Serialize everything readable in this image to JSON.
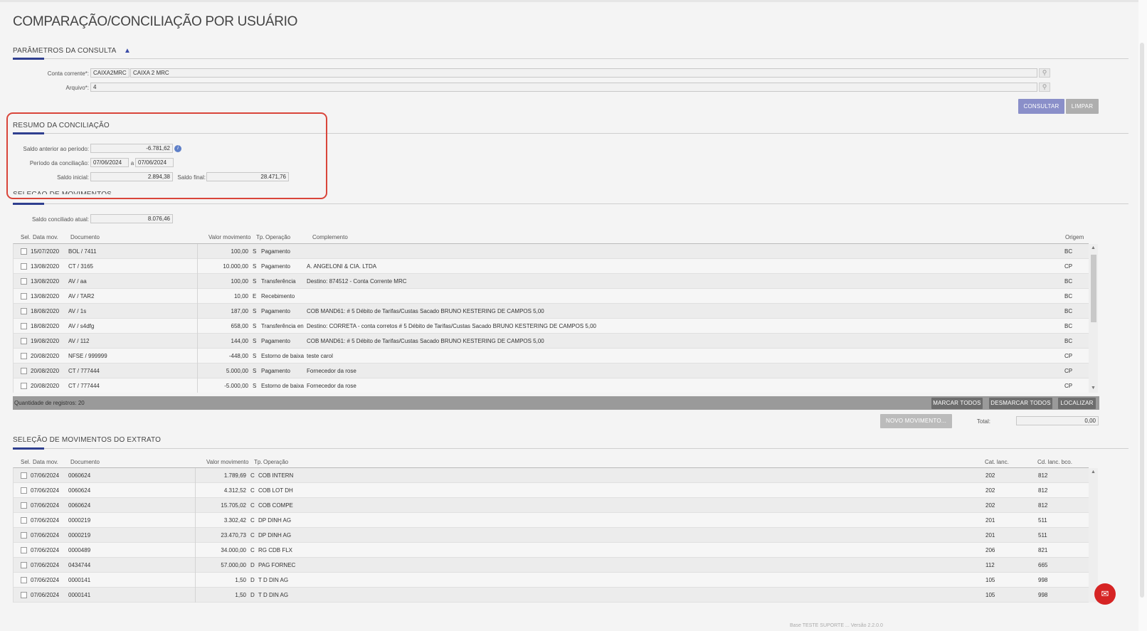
{
  "page_title": "COMPARAÇÃO/CONCILIAÇÃO POR USUÁRIO",
  "params": {
    "title": "PARÂMETROS DA CONSULTA",
    "conta_label": "Conta corrente*:",
    "conta_code": "CAIXA2MRC",
    "conta_name": "CAIXA 2 MRC",
    "arquivo_label": "Arquivo*:",
    "arquivo_value": "4",
    "consultar": "CONSULTAR",
    "limpar": "LIMPAR"
  },
  "resumo": {
    "title": "RESUMO DA CONCILIAÇÃO",
    "saldo_anterior_label": "Saldo anterior ao período:",
    "saldo_anterior": "-6.781,62",
    "periodo_label": "Período da conciliação:",
    "periodo_de": "07/06/2024",
    "periodo_sep": "a",
    "periodo_ate": "07/06/2024",
    "saldo_inicial_label": "Saldo inicial:",
    "saldo_inicial": "2.894,38",
    "saldo_final_label": "Saldo final:",
    "saldo_final": "28.471,76"
  },
  "movimentos": {
    "title": "SELEÇÃO DE MOVIMENTOS",
    "saldo_conciliado_label": "Saldo conciliado atual:",
    "saldo_conciliado": "8.076,46",
    "headers": {
      "sel": "Sel.",
      "data": "Data mov.",
      "documento": "Documento",
      "valor": "Valor movimento",
      "tp": "Tp.",
      "operacao": "Operação",
      "complemento": "Complemento",
      "origem": "Origem"
    },
    "rows": [
      {
        "data": "15/07/2020",
        "doc": "BOL / 7411",
        "valor": "100,00",
        "tp": "S",
        "op": "Pagamento",
        "comp": "",
        "origem": "BC"
      },
      {
        "data": "13/08/2020",
        "doc": "CT / 3165",
        "valor": "10.000,00",
        "tp": "S",
        "op": "Pagamento",
        "comp": "A. ANGELONI & CIA. LTDA",
        "origem": "CP"
      },
      {
        "data": "13/08/2020",
        "doc": "AV / aa",
        "valor": "100,00",
        "tp": "S",
        "op": "Transferência",
        "comp": "Destino: 874512 - Conta Corrente MRC",
        "origem": "BC"
      },
      {
        "data": "13/08/2020",
        "doc": "AV / TAR2",
        "valor": "10,00",
        "tp": "E",
        "op": "Recebimento",
        "comp": "",
        "origem": "BC"
      },
      {
        "data": "18/08/2020",
        "doc": "AV / 1s",
        "valor": "187,00",
        "tp": "S",
        "op": "Pagamento",
        "comp": "COB MAND61: # 5 Débito de Tarifas/Custas Sacado BRUNO KESTERING DE CAMPOS 5,00",
        "origem": "BC"
      },
      {
        "data": "18/08/2020",
        "doc": "AV / s4dfg",
        "valor": "658,00",
        "tp": "S",
        "op": "Transferência en",
        "comp": "Destino: CORRETA - conta corretos # 5 Débito de Tarifas/Custas Sacado BRUNO KESTERING DE CAMPOS 5,00",
        "origem": "BC"
      },
      {
        "data": "19/08/2020",
        "doc": "AV / 112",
        "valor": "144,00",
        "tp": "S",
        "op": "Pagamento",
        "comp": "COB MAND61: # 5 Débito de Tarifas/Custas Sacado BRUNO KESTERING DE CAMPOS 5,00",
        "origem": "BC"
      },
      {
        "data": "20/08/2020",
        "doc": "NFSE / 999999",
        "valor": "-448,00",
        "tp": "S",
        "op": "Estorno de baixa",
        "comp": "teste carol",
        "origem": "CP"
      },
      {
        "data": "20/08/2020",
        "doc": "CT / 777444",
        "valor": "5.000,00",
        "tp": "S",
        "op": "Pagamento",
        "comp": "Fornecedor da rose",
        "origem": "CP"
      },
      {
        "data": "20/08/2020",
        "doc": "CT / 777444",
        "valor": "-5.000,00",
        "tp": "S",
        "op": "Estorno de baixa",
        "comp": "Fornecedor da rose",
        "origem": "CP"
      }
    ],
    "quantidade": "Quantidade de registros: 20",
    "marcar_todos": "MARCAR TODOS",
    "desmarcar_todos": "DESMARCAR TODOS",
    "localizar": "LOCALIZAR",
    "novo_movimento": "NOVO MOVIMENTO...",
    "total_label": "Total:",
    "total_value": "0,00"
  },
  "extrato": {
    "title": "SELEÇÃO DE MOVIMENTOS DO EXTRATO",
    "headers": {
      "sel": "Sel.",
      "data": "Data mov.",
      "documento": "Documento",
      "valor": "Valor movimento",
      "tp": "Tp.",
      "operacao": "Operação",
      "cat": "Cat. lanc.",
      "cd": "Cd. lanc. bco."
    },
    "rows": [
      {
        "data": "07/06/2024",
        "doc": "0060624",
        "valor": "1.789,69",
        "tp": "C",
        "op": "COB INTERN",
        "cat": "202",
        "cd": "812"
      },
      {
        "data": "07/06/2024",
        "doc": "0060624",
        "valor": "4.312,52",
        "tp": "C",
        "op": "COB LOT DH",
        "cat": "202",
        "cd": "812"
      },
      {
        "data": "07/06/2024",
        "doc": "0060624",
        "valor": "15.705,02",
        "tp": "C",
        "op": "COB COMPE",
        "cat": "202",
        "cd": "812"
      },
      {
        "data": "07/06/2024",
        "doc": "0000219",
        "valor": "3.302,42",
        "tp": "C",
        "op": "DP DINH AG",
        "cat": "201",
        "cd": "511"
      },
      {
        "data": "07/06/2024",
        "doc": "0000219",
        "valor": "23.470,73",
        "tp": "C",
        "op": "DP DINH AG",
        "cat": "201",
        "cd": "511"
      },
      {
        "data": "07/06/2024",
        "doc": "0000489",
        "valor": "34.000,00",
        "tp": "C",
        "op": "RG CDB FLX",
        "cat": "206",
        "cd": "821"
      },
      {
        "data": "07/06/2024",
        "doc": "0434744",
        "valor": "57.000,00",
        "tp": "D",
        "op": "PAG FORNEC",
        "cat": "112",
        "cd": "665"
      },
      {
        "data": "07/06/2024",
        "doc": "0000141",
        "valor": "1,50",
        "tp": "D",
        "op": "T D DIN AG",
        "cat": "105",
        "cd": "998"
      },
      {
        "data": "07/06/2024",
        "doc": "0000141",
        "valor": "1,50",
        "tp": "D",
        "op": "T D DIN AG",
        "cat": "105",
        "cd": "998"
      }
    ]
  },
  "status_bar": "Base TESTE SUPORTE ... Versão 2.2.0.0",
  "icons": {
    "home": "home-icon",
    "lookup": "magnifier-icon",
    "info": "info-icon",
    "chat": "chat-icon"
  },
  "colors": {
    "highlight": "#d9453a",
    "accent": "#2f3f8f",
    "consultar": "#8a8fc9",
    "chat": "#d62424"
  }
}
